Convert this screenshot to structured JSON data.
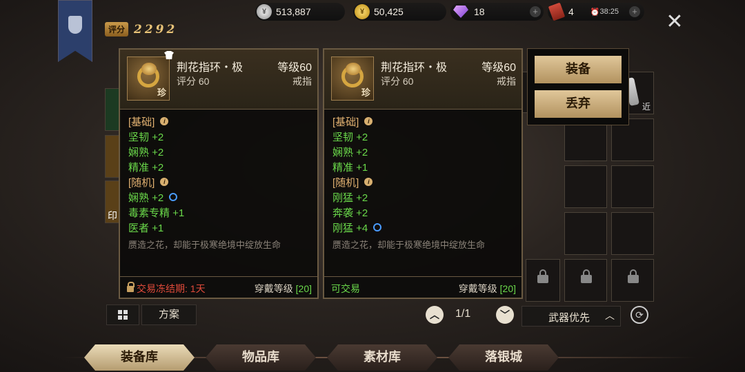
{
  "currencies": {
    "silver": "513,887",
    "gold": "50,425",
    "diamond": "18",
    "tickets": "4",
    "timer": "38:25"
  },
  "score": {
    "label": "评分",
    "value": "2292"
  },
  "tooltips": [
    {
      "name": "荆花指环・极",
      "level": "等级60",
      "score": "评分 60",
      "slot": "戒指",
      "rarity": "珍",
      "basic_label": "[基础]",
      "basic": [
        "坚韧 +2",
        "娴熟 +2",
        "精准 +2"
      ],
      "random_label": "[随机]",
      "random": [
        "娴熟 +2",
        "毒素专精 +1",
        "医者 +1"
      ],
      "desc": "赝造之花，却能于极寒绝境中绽放生命",
      "trade": "交易冻结期: 1天",
      "wear_label": "穿戴等级",
      "wear_level": "[20]"
    },
    {
      "name": "荆花指环・极",
      "level": "等级60",
      "score": "评分 60",
      "slot": "戒指",
      "rarity": "珍",
      "basic_label": "[基础]",
      "basic": [
        "坚韧 +2",
        "娴熟 +2",
        "精准 +1"
      ],
      "random_label": "[随机]",
      "random": [
        "刚猛 +2",
        "奔袭 +2",
        "刚猛 +4"
      ],
      "desc": "赝造之花，却能于极寒绝境中绽放生命",
      "trade": "可交易",
      "wear_label": "穿戴等级",
      "wear_level": "[20]"
    }
  ],
  "actions": {
    "equip": "装备",
    "discard": "丢弃"
  },
  "grid_tags": {
    "near": "近",
    "rare": "珍"
  },
  "left_slot_label": "印",
  "pager": {
    "page": "1/1"
  },
  "sort": {
    "label": "武器优先"
  },
  "scheme": "方案",
  "tabs": [
    "装备库",
    "物品库",
    "素材库",
    "落银城"
  ]
}
